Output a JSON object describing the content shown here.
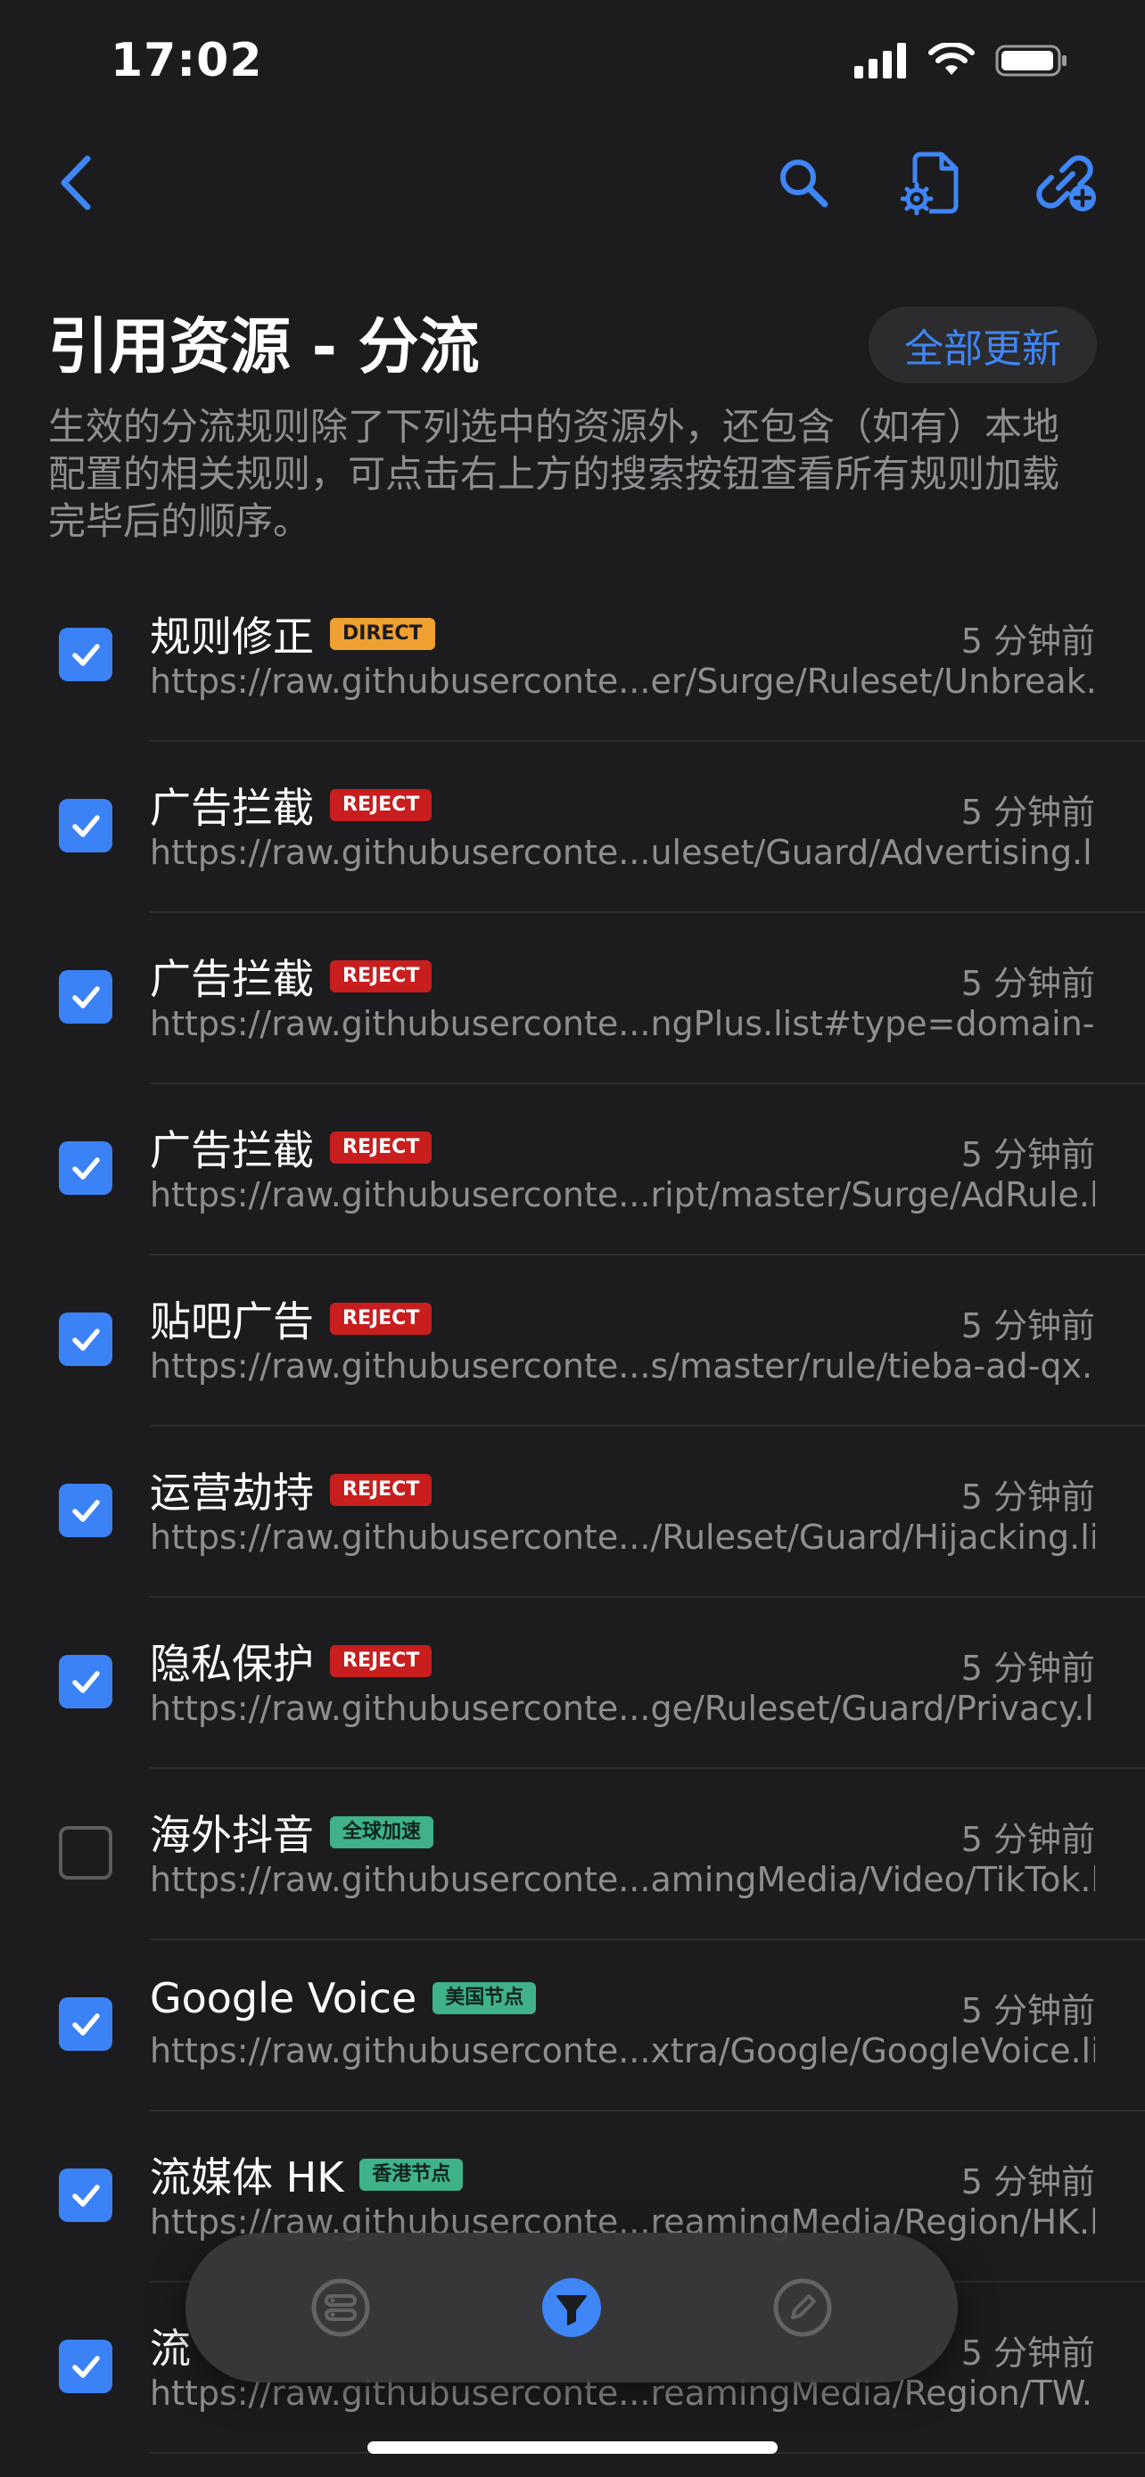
{
  "status": {
    "time": "17:02"
  },
  "header": {
    "title": "引用资源 - 分流",
    "update_all_label": "全部更新",
    "description": "生效的分流规则除了下列选中的资源外，还包含（如有）本地配置的相关规则，可点击右上方的搜索按钮查看所有规则加载完毕后的顺序。"
  },
  "colors": {
    "accent": "#3f86f7",
    "direct": "#f0a030",
    "reject": "#c81e1e",
    "policy_green": "#3fb28a"
  },
  "rows": [
    {
      "name": "规则修正",
      "badge": "DIRECT",
      "badge_type": "direct",
      "time": "5 分钟前",
      "url": "https://raw.githubuserconte...er/Surge/Ruleset/Unbreak.list",
      "checked": true
    },
    {
      "name": "广告拦截",
      "badge": "REJECT",
      "badge_type": "reject",
      "time": "5 分钟前",
      "url": "https://raw.githubuserconte...uleset/Guard/Advertising.list",
      "checked": true
    },
    {
      "name": "广告拦截",
      "badge": "REJECT",
      "badge_type": "reject",
      "time": "5 分钟前",
      "url": "https://raw.githubuserconte...ngPlus.list#type=domain-set",
      "checked": true
    },
    {
      "name": "广告拦截",
      "badge": "REJECT",
      "badge_type": "reject",
      "time": "5 分钟前",
      "url": "https://raw.githubuserconte...ript/master/Surge/AdRule.list",
      "checked": true
    },
    {
      "name": "贴吧广告",
      "badge": "REJECT",
      "badge_type": "reject",
      "time": "5 分钟前",
      "url": "https://raw.githubuserconte...s/master/rule/tieba-ad-qx.list",
      "checked": true
    },
    {
      "name": "运营劫持",
      "badge": "REJECT",
      "badge_type": "reject",
      "time": "5 分钟前",
      "url": "https://raw.githubuserconte.../Ruleset/Guard/Hijacking.list",
      "checked": true
    },
    {
      "name": "隐私保护",
      "badge": "REJECT",
      "badge_type": "reject",
      "time": "5 分钟前",
      "url": "https://raw.githubuserconte...ge/Ruleset/Guard/Privacy.list",
      "checked": true
    },
    {
      "name": "海外抖音",
      "badge": "全球加速",
      "badge_type": "policy",
      "time": "5 分钟前",
      "url": "https://raw.githubuserconte...amingMedia/Video/TikTok.list",
      "checked": false
    },
    {
      "name": "Google Voice",
      "badge": "美国节点",
      "badge_type": "policy",
      "time": "5 分钟前",
      "url": "https://raw.githubuserconte...xtra/Google/GoogleVoice.list",
      "checked": true
    },
    {
      "name": "流媒体 HK",
      "badge": "香港节点",
      "badge_type": "policy",
      "time": "5 分钟前",
      "url": "https://raw.githubuserconte...reamingMedia/Region/HK.list",
      "checked": true
    },
    {
      "name": "流",
      "badge": "",
      "badge_type": "",
      "time": "5 分钟前",
      "url": "https://raw.githubuserconte...reamingMedia/Region/TW.list",
      "checked": true
    }
  ]
}
